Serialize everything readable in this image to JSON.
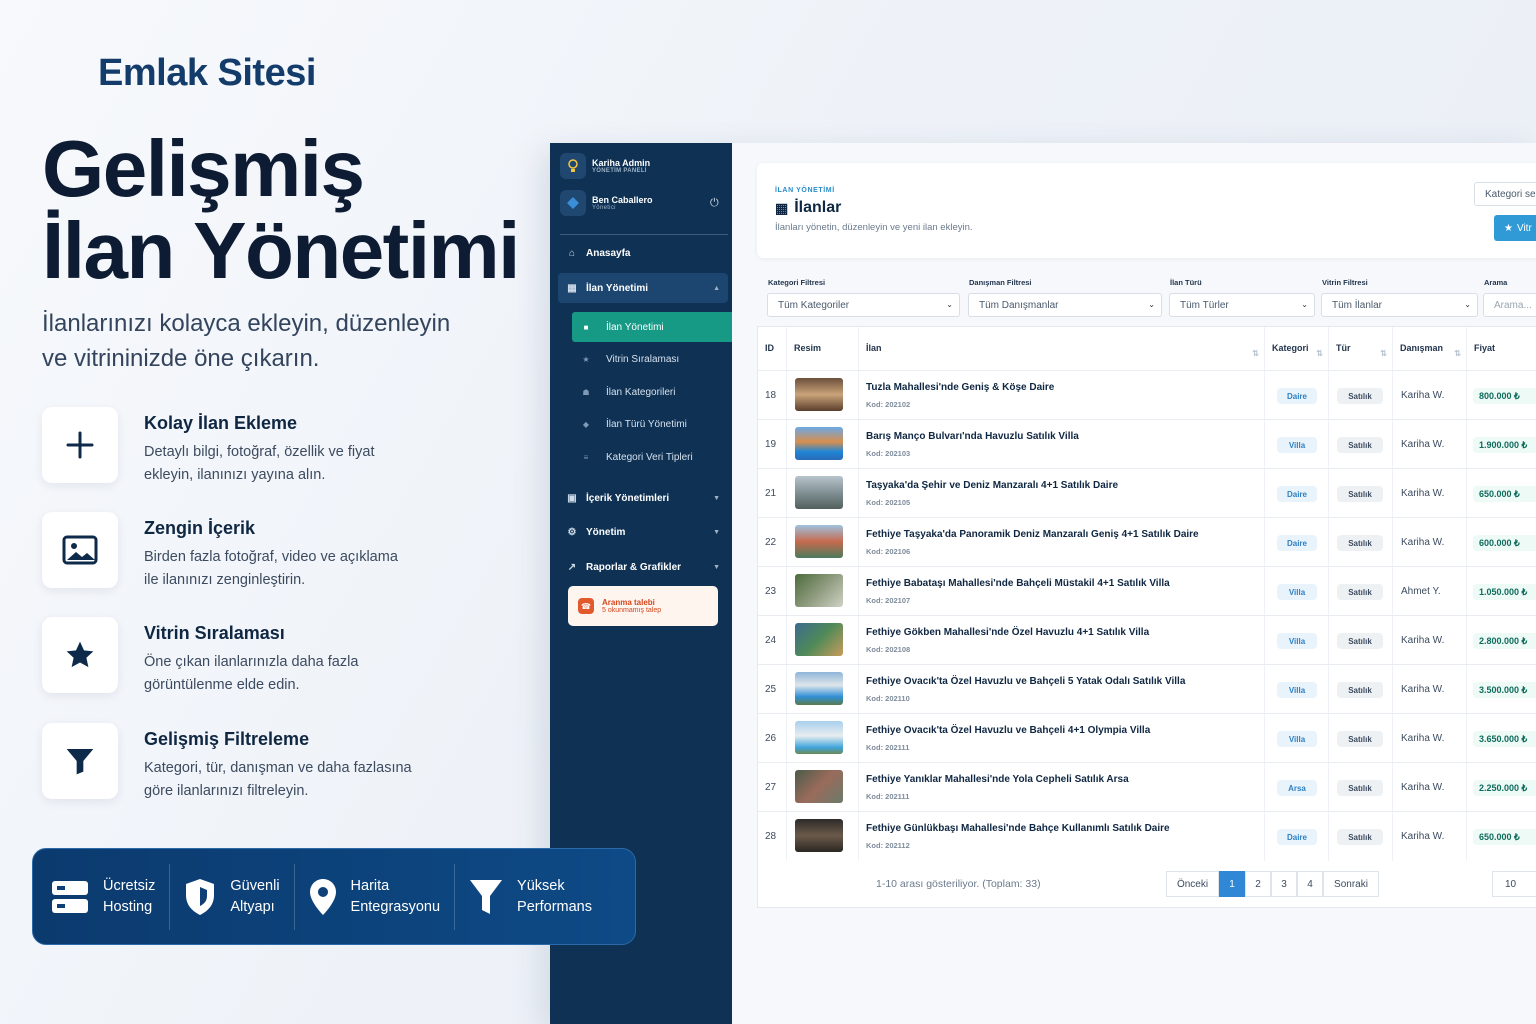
{
  "brand": {
    "logo": "Emlak Sitesi"
  },
  "hero": {
    "title_line1": "Gelişmiş",
    "title_line2": "İlan Yönetimi",
    "subtitle_line1": "İlanlarınızı kolayca ekleyin, düzenleyin",
    "subtitle_line2": "ve vitrininizde öne çıkarın."
  },
  "features": [
    {
      "title": "Kolay İlan Ekleme",
      "desc1": "Detaylı bilgi, fotoğraf, özellik ve fiyat",
      "desc2": "ekleyin, ilanınızı yayına alın.",
      "icon": "plus-icon"
    },
    {
      "title": "Zengin İçerik",
      "desc1": "Birden fazla fotoğraf, video ve açıklama",
      "desc2": "ile ilanınızı zenginleştirin.",
      "icon": "image-icon"
    },
    {
      "title": "Vitrin Sıralaması",
      "desc1": "Öne çıkan ilanlarınızla daha fazla",
      "desc2": "görüntülenme elde edin.",
      "icon": "star-icon"
    },
    {
      "title": "Gelişmiş Filtreleme",
      "desc1": "Kategori, tür, danışman ve daha fazlasına",
      "desc2": "göre ilanlarınızı filtreleyin.",
      "icon": "filter-icon"
    }
  ],
  "bottom_bar": [
    {
      "line1": "Ücretsiz",
      "line2": "Hosting",
      "icon": "server-icon"
    },
    {
      "line1": "Güvenli",
      "line2": "Altyapı",
      "icon": "shield-icon"
    },
    {
      "line1": "Harita",
      "line2": "Entegrasyonu",
      "icon": "map-pin-icon"
    },
    {
      "line1": "Yüksek",
      "line2": "Performans",
      "icon": "funnel-icon"
    }
  ],
  "sidebar": {
    "app_name": "Kariha Admin",
    "app_sub": "YÖNETİM PANELİ",
    "user_name": "Ben Caballero",
    "user_role": "Yönetici",
    "nav": [
      {
        "label": "Anasayfa",
        "icon": "home-icon"
      },
      {
        "label": "İlan Yönetimi",
        "icon": "building-icon"
      },
      {
        "label": "İçerik Yönetimleri",
        "icon": "content-icon"
      },
      {
        "label": "Yönetim",
        "icon": "settings-icon"
      },
      {
        "label": "Raporlar & Grafikler",
        "icon": "chart-icon"
      }
    ],
    "sub_nav": [
      {
        "label": "İlan Yönetimi",
        "icon": "doc-icon"
      },
      {
        "label": "Vitrin Sıralaması",
        "icon": "star-icon"
      },
      {
        "label": "İlan Kategorileri",
        "icon": "sitemap-icon"
      },
      {
        "label": "İlan Türü Yönetimi",
        "icon": "tag-icon"
      },
      {
        "label": "Kategori Veri Tipleri",
        "icon": "list-icon"
      }
    ],
    "request": {
      "title": "Aranma talebi",
      "sub": "5 okunmamış talep"
    }
  },
  "page": {
    "eyebrow": "İLAN YÖNETİMİ",
    "title": "İlanlar",
    "desc": "İlanları yönetin, düzenleyin ve yeni ilan ekleyin.",
    "top_select": "Kategori se",
    "vitrin_button": "Vitr"
  },
  "filters": [
    {
      "label": "Kategori Filtresi",
      "value": "Tüm Kategoriler"
    },
    {
      "label": "Danışman Filtresi",
      "value": "Tüm Danışmanlar"
    },
    {
      "label": "İlan Türü",
      "value": "Tüm Türler"
    },
    {
      "label": "Vitrin Filtresi",
      "value": "Tüm İlanlar"
    },
    {
      "label": "Arama",
      "placeholder": "Arama..."
    }
  ],
  "table": {
    "headers": [
      "ID",
      "Resim",
      "İlan",
      "Kategori",
      "Tür",
      "Danışman",
      "Fiyat"
    ],
    "rows": [
      {
        "id": "18",
        "title": "Tuzla Mahallesi'nde Geniş & Köşe Daire",
        "code": "Kod: 202102",
        "cat": "Daire",
        "type": "Satılık",
        "agent": "Kariha W.",
        "price": "800.000 ₺"
      },
      {
        "id": "19",
        "title": "Barış Manço Bulvarı'nda Havuzlu Satılık Villa",
        "code": "Kod: 202103",
        "cat": "Villa",
        "type": "Satılık",
        "agent": "Kariha W.",
        "price": "1.900.000 ₺"
      },
      {
        "id": "21",
        "title": "Taşyaka'da Şehir ve Deniz Manzaralı 4+1 Satılık Daire",
        "code": "Kod: 202105",
        "cat": "Daire",
        "type": "Satılık",
        "agent": "Kariha W.",
        "price": "650.000 ₺"
      },
      {
        "id": "22",
        "title": "Fethiye Taşyaka'da Panoramik Deniz Manzaralı Geniş 4+1 Satılık Daire",
        "code": "Kod: 202106",
        "cat": "Daire",
        "type": "Satılık",
        "agent": "Kariha W.",
        "price": "600.000 ₺"
      },
      {
        "id": "23",
        "title": "Fethiye Babataşı Mahallesi'nde Bahçeli Müstakil 4+1 Satılık Villa",
        "code": "Kod: 202107",
        "cat": "Villa",
        "type": "Satılık",
        "agent": "Ahmet Y.",
        "price": "1.050.000 ₺"
      },
      {
        "id": "24",
        "title": "Fethiye Gökben Mahallesi'nde Özel Havuzlu 4+1 Satılık Villa",
        "code": "Kod: 202108",
        "cat": "Villa",
        "type": "Satılık",
        "agent": "Kariha W.",
        "price": "2.800.000 ₺"
      },
      {
        "id": "25",
        "title": "Fethiye Ovacık'ta Özel Havuzlu ve Bahçeli 5 Yatak Odalı Satılık Villa",
        "code": "Kod: 202110",
        "cat": "Villa",
        "type": "Satılık",
        "agent": "Kariha W.",
        "price": "3.500.000 ₺"
      },
      {
        "id": "26",
        "title": "Fethiye Ovacık'ta Özel Havuzlu ve Bahçeli 4+1 Olympia Villa",
        "code": "Kod: 202111",
        "cat": "Villa",
        "type": "Satılık",
        "agent": "Kariha W.",
        "price": "3.650.000 ₺"
      },
      {
        "id": "27",
        "title": "Fethiye Yanıklar Mahallesi'nde Yola Cepheli Satılık Arsa",
        "code": "Kod: 202111",
        "cat": "Arsa",
        "type": "Satılık",
        "agent": "Kariha W.",
        "price": "2.250.000 ₺"
      },
      {
        "id": "28",
        "title": "Fethiye Günlükbaşı Mahallesi'nde Bahçe Kullanımlı Satılık Daire",
        "code": "Kod: 202112",
        "cat": "Daire",
        "type": "Satılık",
        "agent": "Kariha W.",
        "price": "650.000 ₺"
      }
    ]
  },
  "pagination": {
    "info": "1-10 arası gösteriliyor. (Toplam: 33)",
    "prev": "Önceki",
    "pages": [
      "1",
      "2",
      "3",
      "4"
    ],
    "next": "Sonraki",
    "page_size": "10"
  },
  "colors": {
    "navy": "#0e3154",
    "teal": "#169a86",
    "accent": "#2f9ad6"
  }
}
